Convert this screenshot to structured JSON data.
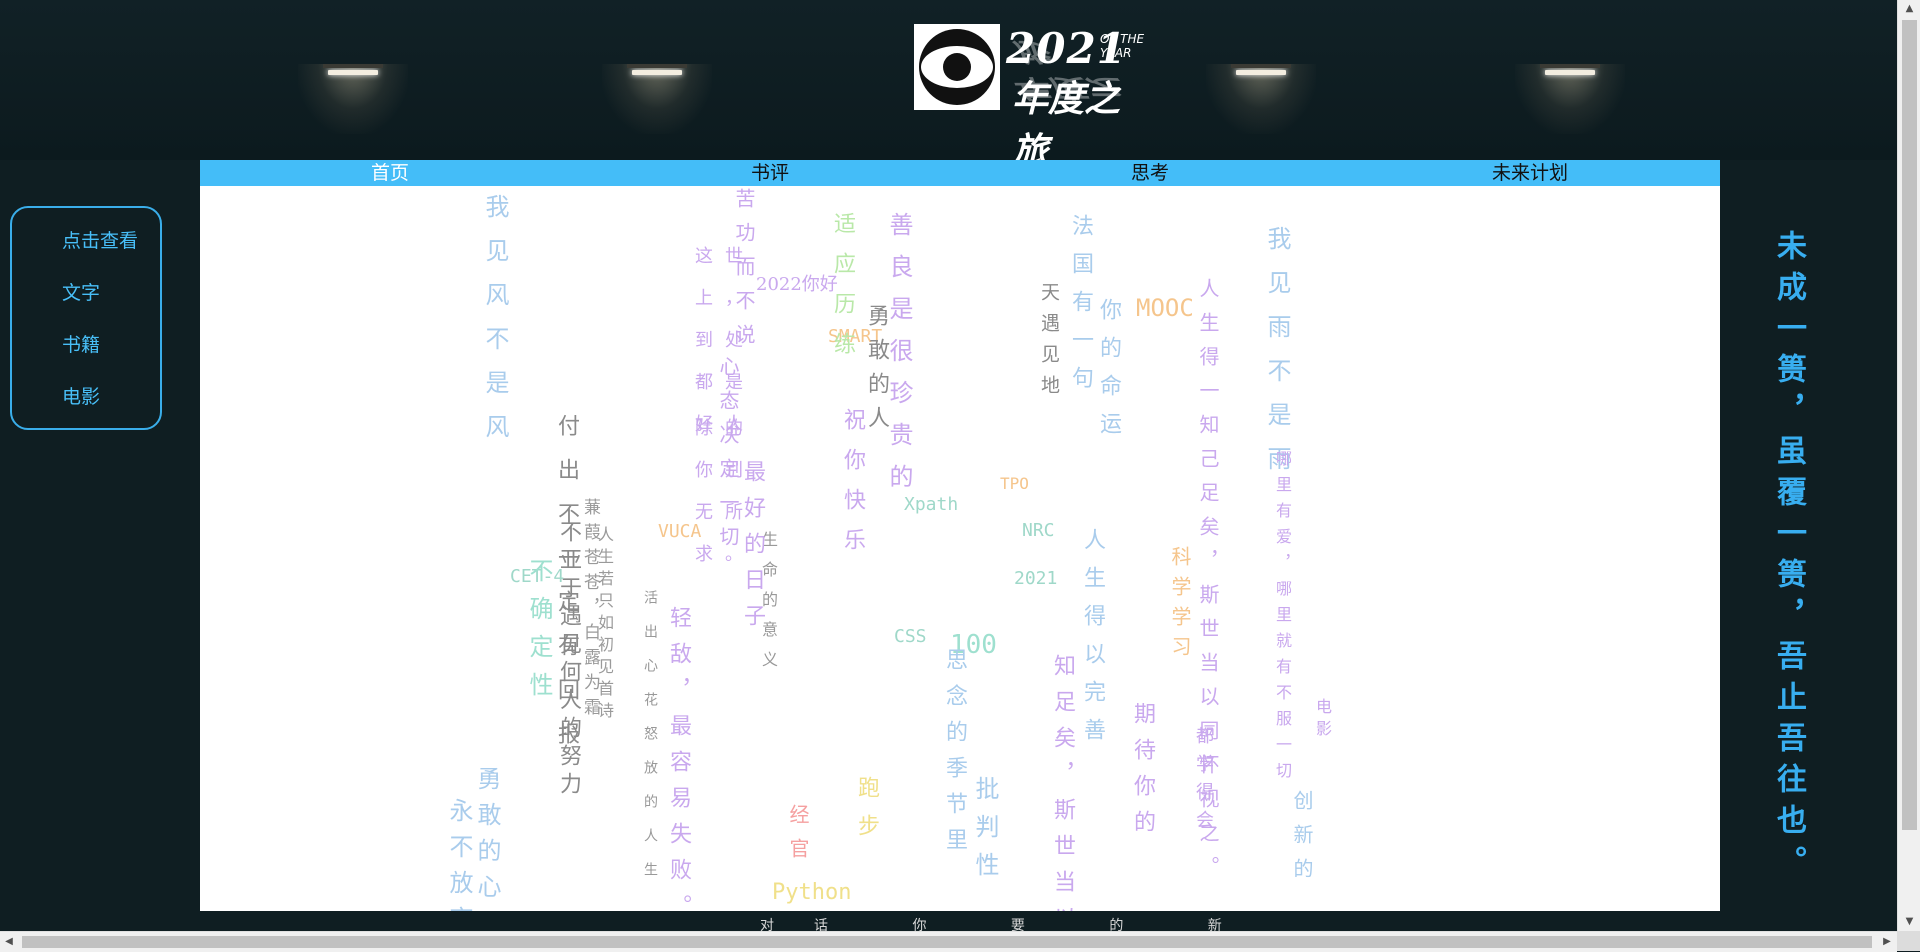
{
  "logo": {
    "year": "2021",
    "of_the_year": "OF THE YEAR",
    "title": "年度之旅",
    "title_reflection": "年度之旅"
  },
  "nav": {
    "items": [
      {
        "label": "首页",
        "active": true
      },
      {
        "label": "书评",
        "active": false
      },
      {
        "label": "思考",
        "active": false
      },
      {
        "label": "未来计划",
        "active": false
      }
    ],
    "background": "#44bdf8"
  },
  "sidebar": {
    "items": [
      "点击查看",
      "文字",
      "书籍",
      "电影"
    ],
    "color": "#48bff8"
  },
  "motto": "未成一篑，虽覆一篑，吾止吾往也。",
  "word_cloud": [
    {
      "text": "我见风不是风",
      "color": "#a9ccec"
    },
    {
      "text": "付出不一定有回报",
      "color": "#8a8a8a"
    },
    {
      "text": "不亚于遇见何人的努力",
      "color": "#8a8a8a"
    },
    {
      "text": "蒹葭苍苍，白露为霜",
      "color": "#9a9a9a"
    },
    {
      "text": "人生若只如初见首诗",
      "color": "#9a9a9a"
    },
    {
      "text": "活出心花怒放的人生",
      "color": "#999999"
    },
    {
      "text": "轻敌，最容易失败。",
      "color": "#c9a8ee"
    },
    {
      "text": "VUCA",
      "color": "#f5c58c"
    },
    {
      "text": "CET-4",
      "color": "#9fd8c9"
    },
    {
      "text": "不确定性",
      "color": "#9ee0cf"
    },
    {
      "text": "勇敢的心",
      "color": "#a9ccec"
    },
    {
      "text": "永不放弃",
      "color": "#a9ccec"
    },
    {
      "text": "这世上，到处都是好人",
      "color": "#c9a8ee"
    },
    {
      "text": "除的你别无所求。",
      "color": "#c9a8ee"
    },
    {
      "text": "苦功而不说",
      "color": "#c9a8ee"
    },
    {
      "text": "心态决定一切",
      "color": "#c9a8ee"
    },
    {
      "text": "2022你好",
      "color": "#c9a8ee"
    },
    {
      "text": "生命的意义",
      "color": "#999999"
    },
    {
      "text": "最好的日子",
      "color": "#c9a8ee"
    },
    {
      "text": "SMART",
      "color": "#f5c58c"
    },
    {
      "text": "适应历练",
      "color": "#b9e8a8"
    },
    {
      "text": "善良是很珍贵的",
      "color": "#c9a8ee"
    },
    {
      "text": "勇敢的人",
      "color": "#8a8a8a"
    },
    {
      "text": "祝你快乐",
      "color": "#c9a8ee"
    },
    {
      "text": "Xpath",
      "color": "#9fd8c9"
    },
    {
      "text": "CSS",
      "color": "#9fd8c9"
    },
    {
      "text": "100",
      "color": "#9ee0cf"
    },
    {
      "text": "思念的季节里",
      "color": "#a9ccec"
    },
    {
      "text": "批判性",
      "color": "#a9ccec"
    },
    {
      "text": "Python",
      "color": "#f0e08a"
    },
    {
      "text": "经官",
      "color": "#f5a0a0"
    },
    {
      "text": "跑步",
      "color": "#f0e08a"
    },
    {
      "text": "天遇见地",
      "color": "#8a8a8a"
    },
    {
      "text": "法国有一句",
      "color": "#a9ccec"
    },
    {
      "text": "你的命运",
      "color": "#a9ccec"
    },
    {
      "text": "NRC",
      "color": "#9fd8c9"
    },
    {
      "text": "2021",
      "color": "#9fd8c9"
    },
    {
      "text": "TPO",
      "color": "#f5c58c"
    },
    {
      "text": "人生得以完善",
      "color": "#a9ccec"
    },
    {
      "text": "知足矣，斯世当以",
      "color": "#c9a8ee"
    },
    {
      "text": "期待你的",
      "color": "#c9a8ee"
    },
    {
      "text": "MOOC",
      "color": "#f5c58c"
    },
    {
      "text": "人生得一知己足矣，斯世当以同怀视之。",
      "color": "#c9a8ee"
    },
    {
      "text": "科学学习",
      "color": "#f5c58c"
    },
    {
      "text": "都学得会",
      "color": "#c9a8ee"
    },
    {
      "text": "我见雨不是雨",
      "color": "#a9ccec"
    },
    {
      "text": "哪里有爱，哪里就有不服一切",
      "color": "#c9a8ee"
    },
    {
      "text": "创新的",
      "color": "#a9ccec"
    },
    {
      "text": "电影",
      "color": "#c9a8ee"
    }
  ],
  "below_text": "对话 你 要 的 新"
}
